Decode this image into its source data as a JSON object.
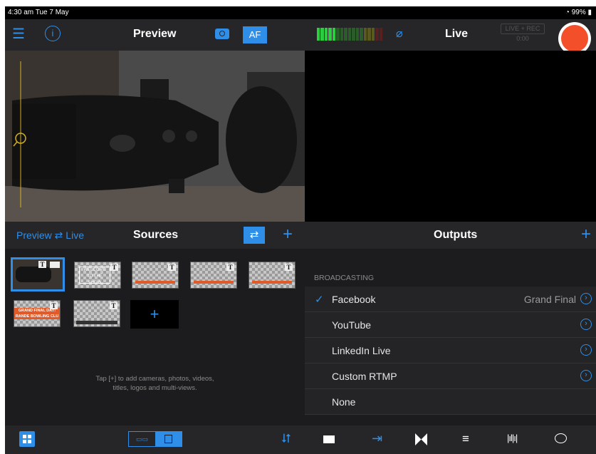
{
  "status": {
    "time": "4:30 am  Tue 7 May",
    "battery": "99%"
  },
  "preview_header": {
    "title": "Preview",
    "af_label": "AF"
  },
  "live_header": {
    "title": "Live",
    "badge_line1": "LIVE + REC",
    "badge_line2": "0:00"
  },
  "sources_bar": {
    "preview_live_label": "Preview ⇄ Live",
    "title": "Sources",
    "add_label": "+"
  },
  "outputs_bar": {
    "title": "Outputs",
    "add_label": "+"
  },
  "sources": {
    "thumb_welcome_line1": "WELCOME",
    "thumb_welcome_line2": "TO THE SHOW",
    "thumb_grand_line1": "GRAND FINAL DAY!",
    "thumb_grand_line2": "RANDE BOWLING CLU",
    "t_glyph": "T",
    "hint_line1": "Tap [+] to add cameras, photos, videos,",
    "hint_line2": "titles, logos and multi-views."
  },
  "outputs": {
    "section_header": "BROADCASTING",
    "items": [
      {
        "label": "Facebook",
        "value": "Grand Final",
        "checked": true,
        "chevron": true
      },
      {
        "label": "YouTube",
        "value": "",
        "checked": false,
        "chevron": true
      },
      {
        "label": "LinkedIn Live",
        "value": "",
        "checked": false,
        "chevron": true
      },
      {
        "label": "Custom RTMP",
        "value": "",
        "checked": false,
        "chevron": true
      },
      {
        "label": "None",
        "value": "",
        "checked": false,
        "chevron": false
      }
    ]
  },
  "colors": {
    "accent": "#2f8ee8",
    "record": "#f24f2a",
    "panel": "#1c1c1e"
  }
}
